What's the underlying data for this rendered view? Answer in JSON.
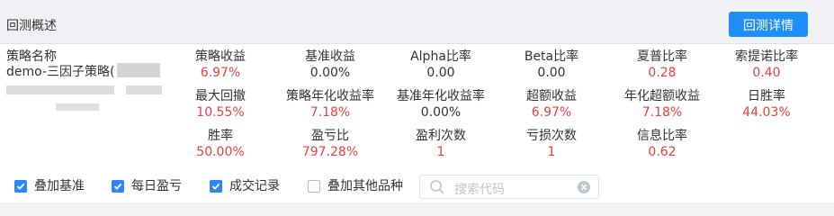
{
  "header": {
    "title": "回测概述",
    "detail_button": "回测详情"
  },
  "strategy": {
    "label": "策略名称",
    "name": "demo-三因子策略("
  },
  "metrics": [
    {
      "label": "策略收益",
      "value": "6.97%",
      "color": "red"
    },
    {
      "label": "基准收益",
      "value": "0.00%",
      "color": "black"
    },
    {
      "label": "Alpha比率",
      "value": "0.00",
      "color": "black"
    },
    {
      "label": "Beta比率",
      "value": "0.00",
      "color": "black"
    },
    {
      "label": "夏普比率",
      "value": "0.28",
      "color": "red"
    },
    {
      "label": "索提诺比率",
      "value": "0.40",
      "color": "red"
    },
    {
      "label": "最大回撤",
      "value": "10.55%",
      "color": "red"
    },
    {
      "label": "策略年化收益率",
      "value": "7.18%",
      "color": "red"
    },
    {
      "label": "基准年化收益率",
      "value": "0.00%",
      "color": "black"
    },
    {
      "label": "超额收益",
      "value": "6.97%",
      "color": "red"
    },
    {
      "label": "年化超额收益",
      "value": "7.18%",
      "color": "red"
    },
    {
      "label": "日胜率",
      "value": "44.03%",
      "color": "red"
    },
    {
      "label": "胜率",
      "value": "50.00%",
      "color": "red"
    },
    {
      "label": "盈亏比",
      "value": "797.28%",
      "color": "red"
    },
    {
      "label": "盈利次数",
      "value": "1",
      "color": "red"
    },
    {
      "label": "亏损次数",
      "value": "1",
      "color": "red"
    },
    {
      "label": "信息比率",
      "value": "0.62",
      "color": "red"
    }
  ],
  "options": [
    {
      "label": "叠加基准",
      "checked": true
    },
    {
      "label": "每日盈亏",
      "checked": true
    },
    {
      "label": "成交记录",
      "checked": true
    },
    {
      "label": "叠加其他品种",
      "checked": false
    }
  ],
  "search": {
    "placeholder": "搜索代码"
  },
  "colors": {
    "accent": "#1e8ff8",
    "positive": "#e9403f",
    "checkbox": "#2f86f6"
  }
}
